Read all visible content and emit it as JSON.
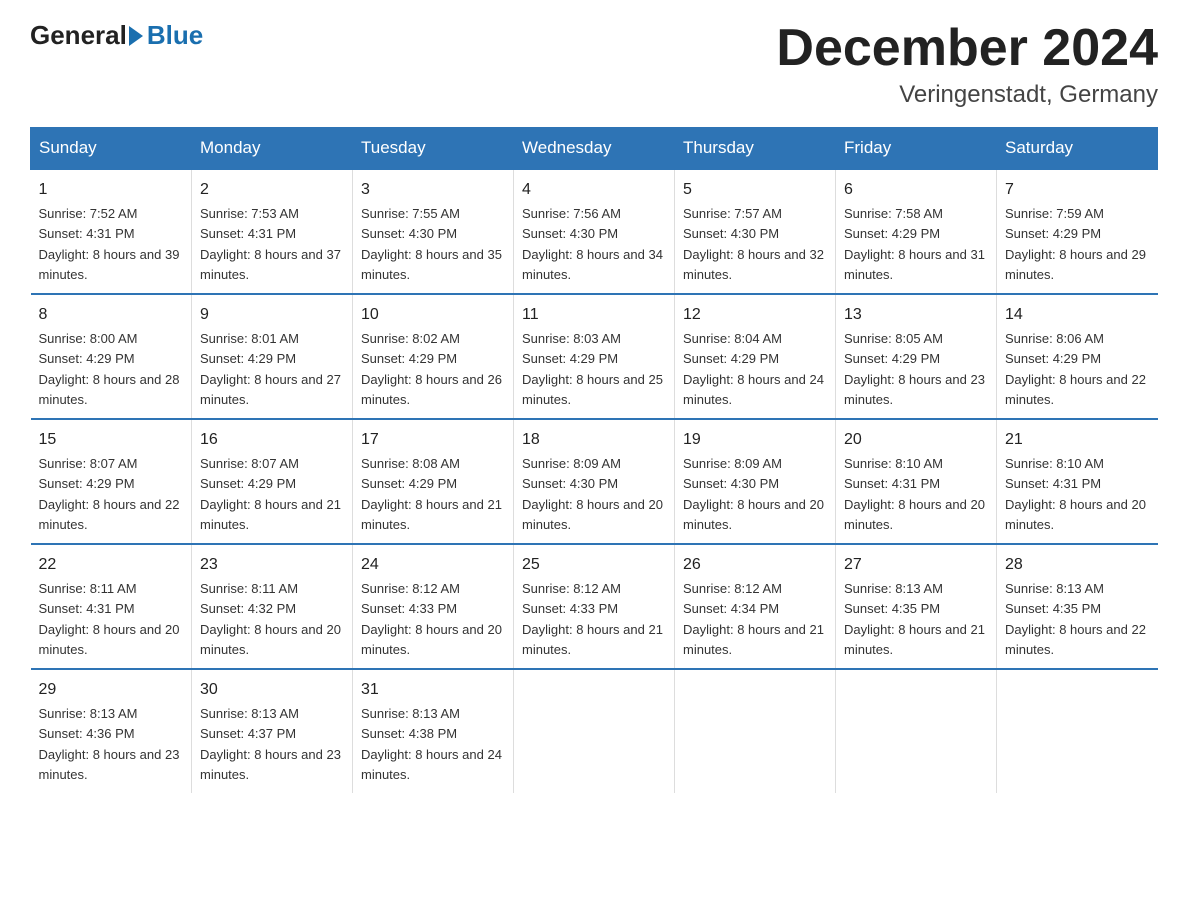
{
  "header": {
    "logo_general": "General",
    "logo_blue": "Blue",
    "month_title": "December 2024",
    "location": "Veringenstadt, Germany"
  },
  "days_of_week": [
    "Sunday",
    "Monday",
    "Tuesday",
    "Wednesday",
    "Thursday",
    "Friday",
    "Saturday"
  ],
  "weeks": [
    [
      {
        "day": "1",
        "sunrise": "7:52 AM",
        "sunset": "4:31 PM",
        "daylight": "8 hours and 39 minutes."
      },
      {
        "day": "2",
        "sunrise": "7:53 AM",
        "sunset": "4:31 PM",
        "daylight": "8 hours and 37 minutes."
      },
      {
        "day": "3",
        "sunrise": "7:55 AM",
        "sunset": "4:30 PM",
        "daylight": "8 hours and 35 minutes."
      },
      {
        "day": "4",
        "sunrise": "7:56 AM",
        "sunset": "4:30 PM",
        "daylight": "8 hours and 34 minutes."
      },
      {
        "day": "5",
        "sunrise": "7:57 AM",
        "sunset": "4:30 PM",
        "daylight": "8 hours and 32 minutes."
      },
      {
        "day": "6",
        "sunrise": "7:58 AM",
        "sunset": "4:29 PM",
        "daylight": "8 hours and 31 minutes."
      },
      {
        "day": "7",
        "sunrise": "7:59 AM",
        "sunset": "4:29 PM",
        "daylight": "8 hours and 29 minutes."
      }
    ],
    [
      {
        "day": "8",
        "sunrise": "8:00 AM",
        "sunset": "4:29 PM",
        "daylight": "8 hours and 28 minutes."
      },
      {
        "day": "9",
        "sunrise": "8:01 AM",
        "sunset": "4:29 PM",
        "daylight": "8 hours and 27 minutes."
      },
      {
        "day": "10",
        "sunrise": "8:02 AM",
        "sunset": "4:29 PM",
        "daylight": "8 hours and 26 minutes."
      },
      {
        "day": "11",
        "sunrise": "8:03 AM",
        "sunset": "4:29 PM",
        "daylight": "8 hours and 25 minutes."
      },
      {
        "day": "12",
        "sunrise": "8:04 AM",
        "sunset": "4:29 PM",
        "daylight": "8 hours and 24 minutes."
      },
      {
        "day": "13",
        "sunrise": "8:05 AM",
        "sunset": "4:29 PM",
        "daylight": "8 hours and 23 minutes."
      },
      {
        "day": "14",
        "sunrise": "8:06 AM",
        "sunset": "4:29 PM",
        "daylight": "8 hours and 22 minutes."
      }
    ],
    [
      {
        "day": "15",
        "sunrise": "8:07 AM",
        "sunset": "4:29 PM",
        "daylight": "8 hours and 22 minutes."
      },
      {
        "day": "16",
        "sunrise": "8:07 AM",
        "sunset": "4:29 PM",
        "daylight": "8 hours and 21 minutes."
      },
      {
        "day": "17",
        "sunrise": "8:08 AM",
        "sunset": "4:29 PM",
        "daylight": "8 hours and 21 minutes."
      },
      {
        "day": "18",
        "sunrise": "8:09 AM",
        "sunset": "4:30 PM",
        "daylight": "8 hours and 20 minutes."
      },
      {
        "day": "19",
        "sunrise": "8:09 AM",
        "sunset": "4:30 PM",
        "daylight": "8 hours and 20 minutes."
      },
      {
        "day": "20",
        "sunrise": "8:10 AM",
        "sunset": "4:31 PM",
        "daylight": "8 hours and 20 minutes."
      },
      {
        "day": "21",
        "sunrise": "8:10 AM",
        "sunset": "4:31 PM",
        "daylight": "8 hours and 20 minutes."
      }
    ],
    [
      {
        "day": "22",
        "sunrise": "8:11 AM",
        "sunset": "4:31 PM",
        "daylight": "8 hours and 20 minutes."
      },
      {
        "day": "23",
        "sunrise": "8:11 AM",
        "sunset": "4:32 PM",
        "daylight": "8 hours and 20 minutes."
      },
      {
        "day": "24",
        "sunrise": "8:12 AM",
        "sunset": "4:33 PM",
        "daylight": "8 hours and 20 minutes."
      },
      {
        "day": "25",
        "sunrise": "8:12 AM",
        "sunset": "4:33 PM",
        "daylight": "8 hours and 21 minutes."
      },
      {
        "day": "26",
        "sunrise": "8:12 AM",
        "sunset": "4:34 PM",
        "daylight": "8 hours and 21 minutes."
      },
      {
        "day": "27",
        "sunrise": "8:13 AM",
        "sunset": "4:35 PM",
        "daylight": "8 hours and 21 minutes."
      },
      {
        "day": "28",
        "sunrise": "8:13 AM",
        "sunset": "4:35 PM",
        "daylight": "8 hours and 22 minutes."
      }
    ],
    [
      {
        "day": "29",
        "sunrise": "8:13 AM",
        "sunset": "4:36 PM",
        "daylight": "8 hours and 23 minutes."
      },
      {
        "day": "30",
        "sunrise": "8:13 AM",
        "sunset": "4:37 PM",
        "daylight": "8 hours and 23 minutes."
      },
      {
        "day": "31",
        "sunrise": "8:13 AM",
        "sunset": "4:38 PM",
        "daylight": "8 hours and 24 minutes."
      },
      null,
      null,
      null,
      null
    ]
  ]
}
